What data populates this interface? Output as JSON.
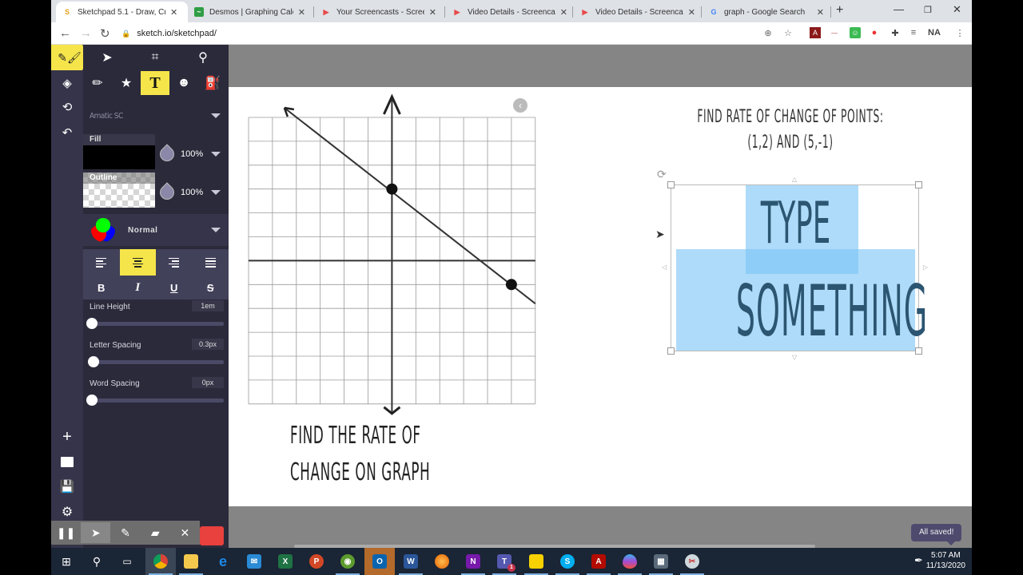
{
  "browser": {
    "tabs": [
      {
        "title": "Sketchpad 5.1 - Draw, Cre",
        "icon": "sketchpad-icon",
        "active": true
      },
      {
        "title": "Desmos | Graphing Calcul",
        "icon": "desmos-icon",
        "active": false
      },
      {
        "title": "Your Screencasts - Screen",
        "icon": "screencastify-icon",
        "active": false
      },
      {
        "title": "Video Details - Screencas",
        "icon": "screencastify-icon",
        "active": false
      },
      {
        "title": "Video Details - Screencas",
        "icon": "screencastify-icon",
        "active": false
      },
      {
        "title": "graph - Google Search",
        "icon": "google-icon",
        "active": false
      }
    ],
    "url": "sketch.io/sketchpad/",
    "profile_label": "NA"
  },
  "sketchpad": {
    "font_name": "Amatic SC",
    "fill": {
      "label": "Fill",
      "opacity": "100%",
      "color": "#000000"
    },
    "outline": {
      "label": "Outline",
      "opacity": "100%",
      "color": "transparent"
    },
    "blend_mode": "Normal",
    "alignment_selected": "center",
    "styles": {
      "bold": "B",
      "italic": "I",
      "underline": "U",
      "strike": "S"
    },
    "line_height": {
      "label": "Line Height",
      "value": "1em"
    },
    "letter_spacing": {
      "label": "Letter Spacing",
      "value": "0.3px"
    },
    "word_spacing": {
      "label": "Word Spacing",
      "value": "0px"
    },
    "accent_color": "#f5e54a",
    "saved_status": "All saved!"
  },
  "canvas": {
    "graph_caption_line1": "FIND THE RATE OF",
    "graph_caption_line2": "CHANGE ON GRAPH",
    "problem_line1": "FIND RATE OF CHANGE OF POINTS:",
    "problem_line2": "(1,2) AND (5,-1)",
    "textbox_line1": "TYPE",
    "textbox_line2": "SOMETHING"
  },
  "chart_data": {
    "type": "line",
    "title": "",
    "xlabel": "",
    "ylabel": "",
    "xlim": [
      -6,
      6
    ],
    "ylim": [
      -6,
      6
    ],
    "grid": true,
    "line": {
      "x": [
        -4.5,
        6
      ],
      "y": [
        6.4,
        -1.8
      ],
      "slope": -0.8,
      "intercept": 3
    },
    "points": [
      {
        "x": 0,
        "y": 3
      },
      {
        "x": 5,
        "y": -1
      }
    ]
  },
  "taskbar": {
    "apps": [
      "windows-start",
      "search",
      "task-view",
      "chrome",
      "file-explorer",
      "edge",
      "mail",
      "excel",
      "powerpoint",
      "camera",
      "outlook",
      "word",
      "firefox",
      "onenote",
      "teams",
      "sticky-notes",
      "skype",
      "acrobat",
      "paint-3d",
      "calculator",
      "snipping-tool"
    ],
    "teams_badge": "1",
    "time": "5:07 AM",
    "date": "11/13/2020"
  }
}
